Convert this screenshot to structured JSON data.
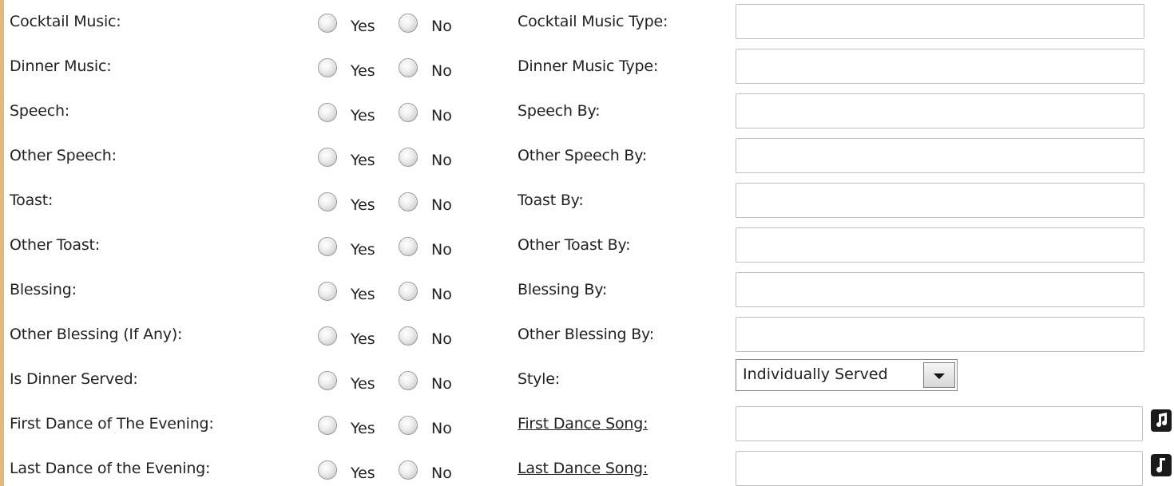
{
  "yes_label": "Yes",
  "no_label": "No",
  "rows": [
    {
      "label": "Cocktail Music:",
      "right_label": "Cocktail Music Type:",
      "value": ""
    },
    {
      "label": "Dinner Music:",
      "right_label": "Dinner Music Type:",
      "value": ""
    },
    {
      "label": "Speech:",
      "right_label": "Speech By:",
      "value": ""
    },
    {
      "label": "Other Speech:",
      "right_label": "Other Speech By:",
      "value": ""
    },
    {
      "label": "Toast:",
      "right_label": "Toast By:",
      "value": ""
    },
    {
      "label": "Other Toast:",
      "right_label": "Other Toast By:",
      "value": ""
    },
    {
      "label": "Blessing:",
      "right_label": "Blessing By:",
      "value": ""
    },
    {
      "label": "Other Blessing (If Any):",
      "right_label": "Other Blessing By:",
      "value": ""
    },
    {
      "label": "Is Dinner Served:",
      "right_label": "Style:",
      "select_value": "Individually Served"
    },
    {
      "label": "First Dance of The Evening:",
      "right_label": "First Dance Song:",
      "value": "",
      "icon": "music-note-icon"
    },
    {
      "label": "Last Dance of the Evening:",
      "right_label": "Last Dance Song:",
      "value": "",
      "icon": "music-note-icon"
    }
  ],
  "colors": {
    "accent_border": "#e2b87b"
  }
}
